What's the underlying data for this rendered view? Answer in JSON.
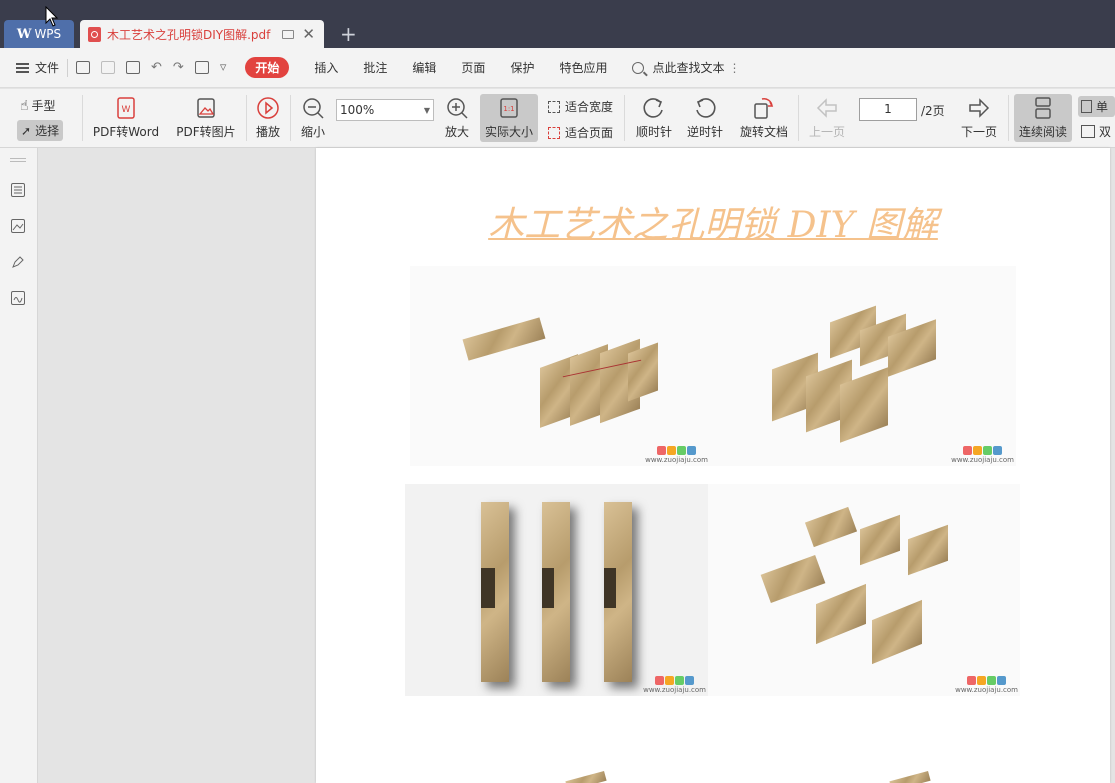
{
  "titlebar": {
    "app_tab_label": "WPS",
    "document_tab_title": "木工艺术之孔明锁DIY图解.pdf"
  },
  "menubar": {
    "file_label": "文件",
    "start_label": "开始",
    "tabs": [
      "插入",
      "批注",
      "编辑",
      "页面",
      "保护",
      "特色应用"
    ],
    "search_label": "点此查找文本"
  },
  "toolbar": {
    "hand_label": "手型",
    "select_label": "选择",
    "pdf_to_word_label": "PDF转Word",
    "pdf_to_image_label": "PDF转图片",
    "play_label": "播放",
    "zoom_out_label": "缩小",
    "zoom_value": "100%",
    "zoom_in_label": "放大",
    "actual_size_label": "实际大小",
    "fit_width_label": "适合宽度",
    "fit_page_label": "适合页面",
    "rotate_cw_label": "顺时针",
    "rotate_ccw_label": "逆时针",
    "rotate_doc_label": "旋转文档",
    "prev_page_label": "上一页",
    "page_input_value": "1",
    "page_total_label": "/2页",
    "next_page_label": "下一页",
    "continuous_label": "连续阅读",
    "single_label": "单",
    "double_label": "双"
  },
  "document": {
    "title": "木工艺术之孔明锁 DIY 图解",
    "watermark_url": "www.zuojiaju.com"
  },
  "colors": {
    "titlebar_bg": "#3a3d4c",
    "wps_tab_bg": "#4f6faa",
    "start_tab_bg": "#e2433f",
    "doc_title_color": "#f5c28c"
  }
}
